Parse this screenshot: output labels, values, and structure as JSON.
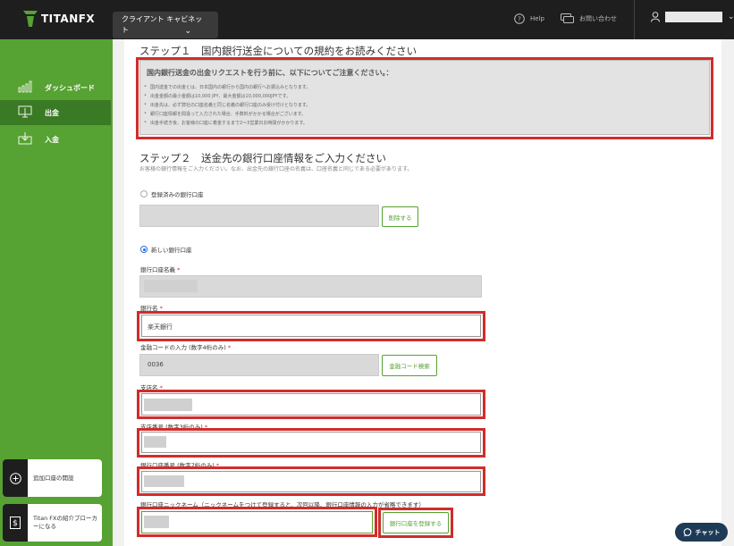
{
  "header": {
    "brand": "TITANFX",
    "client_cabinet": "クライアント キャビネット",
    "help": "Help",
    "contact": "お問い合わせ"
  },
  "sidebar": {
    "items": [
      {
        "label": "ダッシュボード",
        "icon": "bar-chart-icon"
      },
      {
        "label": "出金",
        "icon": "monitor-withdraw-icon"
      },
      {
        "label": "入金",
        "icon": "deposit-icon"
      }
    ],
    "cards": [
      {
        "label": "追加口座の開設",
        "icon": "plus-circle-icon"
      },
      {
        "label": "Titan FXの紹介ブローカーになる",
        "icon": "dollar-doc-icon"
      }
    ]
  },
  "step1": {
    "heading": "ステップ１　国内銀行送金についての規約をお読みください",
    "notice_title": "国内銀行送金の出金リクエストを行う前に、以下についてご注意ください。：",
    "notice_lines": [
      "国内送金での出金とは、日本国内の銀行から国内の銀行へお振込みとなります。",
      "出金金額の最小金額は10,000 JPY、最大金額は10,000,000JPYです。",
      "出金先は、必ず弊社の口座名義と同じ名義の銀行口座のみ受け付けとなります。",
      "銀行口座情報を間違って入力された場合、手数料がかかる場合がございます。",
      "出金手続き後、お客様の口座に着金するまで2～3営業日お時間がかかります。"
    ]
  },
  "step2": {
    "heading": "ステップ２　送金先の銀行口座情報をご入力ください",
    "note": "お客様の銀行情報をご入力ください。なお、出金先の銀行口座の名義は、口座名義と同じである必要があります。",
    "registered_label": "登録済みの銀行口座",
    "delete_button": "削除する",
    "new_account_label": "新しい銀行口座",
    "account_holder_label": "銀行口座名義",
    "bank_name_label": "銀行名",
    "bank_name_value": "楽天銀行",
    "bank_code_label": "金融コードの入力 (数字4桁のみ)",
    "bank_code_value": "0036",
    "bank_code_button": "金融コード検索",
    "branch_name_label": "支店名",
    "branch_number_label": "支店番号 (数字3桁のみ)",
    "account_number_label": "銀行口座番号 (数字7桁のみ)",
    "nickname_label": "銀行口座ニックネーム（ニックネームをつけて登録すると、次回以降、銀行口座情報の入力が省略できます）",
    "register_button": "銀行口座を登録する",
    "required_mark": "*"
  },
  "chat": {
    "label": "チャット"
  }
}
